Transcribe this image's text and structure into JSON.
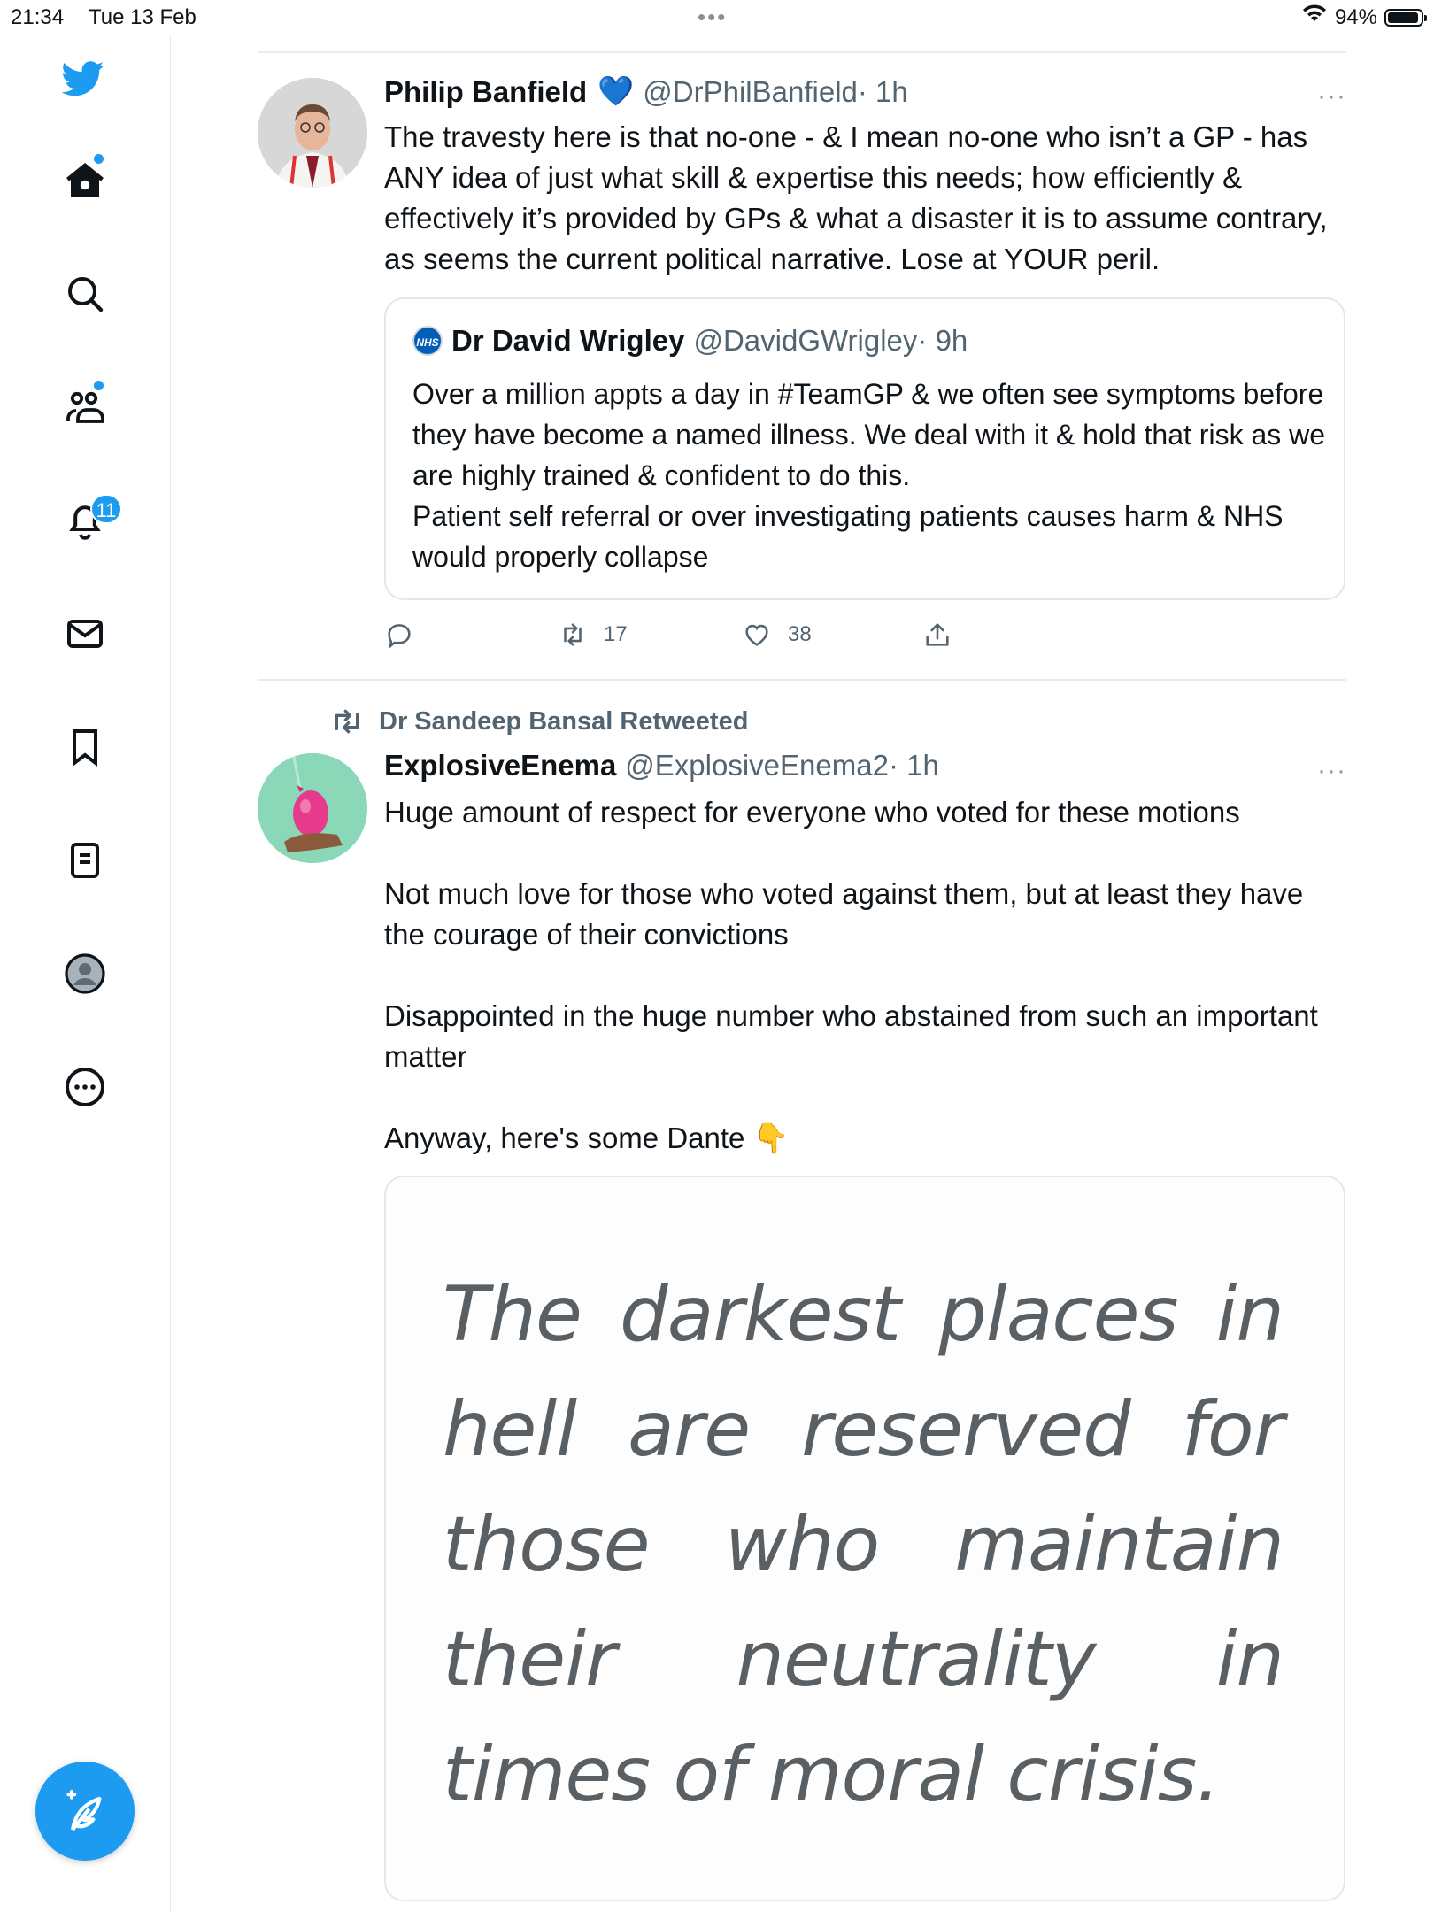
{
  "status_bar": {
    "time": "21:34",
    "date": "Tue 13 Feb",
    "battery": "94%",
    "battery_level": 0.94
  },
  "sidebar": {
    "items": [
      {
        "name": "home",
        "icon": "home-icon",
        "has_dot": true
      },
      {
        "name": "explore",
        "icon": "search-icon"
      },
      {
        "name": "communities",
        "icon": "communities-icon",
        "has_dot": true
      },
      {
        "name": "notifications",
        "icon": "bell-icon",
        "badge": "11"
      },
      {
        "name": "messages",
        "icon": "envelope-icon"
      },
      {
        "name": "bookmarks",
        "icon": "bookmark-icon"
      },
      {
        "name": "lists",
        "icon": "list-icon"
      },
      {
        "name": "profile",
        "icon": "profile-avatar-icon"
      },
      {
        "name": "more",
        "icon": "more-circle-icon"
      }
    ],
    "compose_icon": "compose-feather-icon",
    "accent_color": "#1d9bf0"
  },
  "tweets": [
    {
      "author_name": "Philip Banfield",
      "verified_emoji": "💙",
      "handle": "@DrPhilBanfield",
      "time": " · 1h",
      "text": "The travesty here is that no-one - & I mean no-one who isn’t a GP - has ANY idea of just what skill & expertise this needs; how efficiently & effectively it’s provided by GPs & what a disaster it is to assume contrary, as seems the current political narrative. Lose at YOUR peril.",
      "quote": {
        "logo_text": "NHS",
        "author_name": "Dr David Wrigley",
        "handle": "@DavidGWrigley",
        "time": " · 9h",
        "text": "Over a million appts a day in #TeamGP & we often see symptoms before they have become a named illness. We deal with it & hold that risk as we are highly trained & confident to do this.\nPatient self referral or over investigating patients causes harm & NHS would properly collapse"
      },
      "retweet_count": "17",
      "like_count": "38"
    },
    {
      "retweeted_by": "Dr Sandeep Bansal Retweeted",
      "author_name": "ExplosiveEnema",
      "handle": "@ExplosiveEnema2",
      "time": " · 1h",
      "text": "Huge amount of respect for everyone who voted for these motions\n\nNot much love for those who voted against them, but at least they have the courage of their convictions\n\nDisappointed in the huge number who abstained from such an important matter\n\nAnyway, here's some Dante 👇",
      "image_text": "The darkest places in hell are reserved for those who maintain their neutrality in times of moral crisis."
    }
  ]
}
